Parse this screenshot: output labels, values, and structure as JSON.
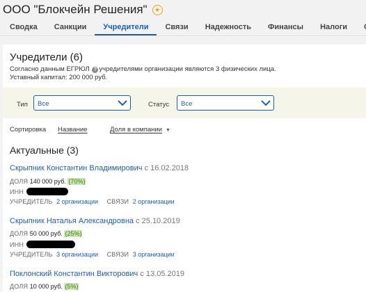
{
  "company": {
    "name": "ООО \"Блокчейн Решения\""
  },
  "tabs": [
    {
      "label": "Сводка"
    },
    {
      "label": "Санкции"
    },
    {
      "label": "Учредители",
      "active": true
    },
    {
      "label": "Связи"
    },
    {
      "label": "Надежность"
    },
    {
      "label": "Финансы"
    },
    {
      "label": "Налоги"
    },
    {
      "label": "Суд"
    }
  ],
  "main": {
    "title": "Учредители (6)",
    "info_prefix": "Согласно данным ЕГРЮЛ",
    "info_suffix": "учредителями организации являются 3 физических лица.",
    "capital": "Уставный капитал: 200 000 руб.",
    "filters": {
      "type_label": "Тип",
      "type_value": "Все",
      "status_label": "Статус",
      "status_value": "Все"
    },
    "sort": {
      "label": "Сортировка",
      "by_name": "Название",
      "by_share": "Доля в компании"
    },
    "section_title": "Актуальные (3)",
    "labels": {
      "share": "ДОЛЯ",
      "inn": "ИНН",
      "founder": "УЧРЕДИТЕЛЬ",
      "links": "СВЯЗИ"
    },
    "persons": [
      {
        "name": "Скрыпник Константин Владимирович",
        "since": "с 16.02.2018",
        "share_value": "140 000 руб.",
        "share_percent": "(70%)",
        "founder_link": "2 организации",
        "links_link": "2 организации"
      },
      {
        "name": "Скрыпник Наталья Александровна",
        "since": "с 25.10.2019",
        "share_value": "50 000 руб.",
        "share_percent": "(25%)",
        "founder_link": "3 организации",
        "links_link": "3 организации"
      },
      {
        "name": "Поклонский Константин Викторович",
        "since": "с 13.05.2019",
        "share_value": "10 000 руб.",
        "share_percent": "(5%)"
      }
    ]
  },
  "colors": {
    "accent": "#1a5fb4",
    "filter_bar": "#f6f5e9",
    "percent_badge": "#cde8b4",
    "star": "#e8a317"
  }
}
